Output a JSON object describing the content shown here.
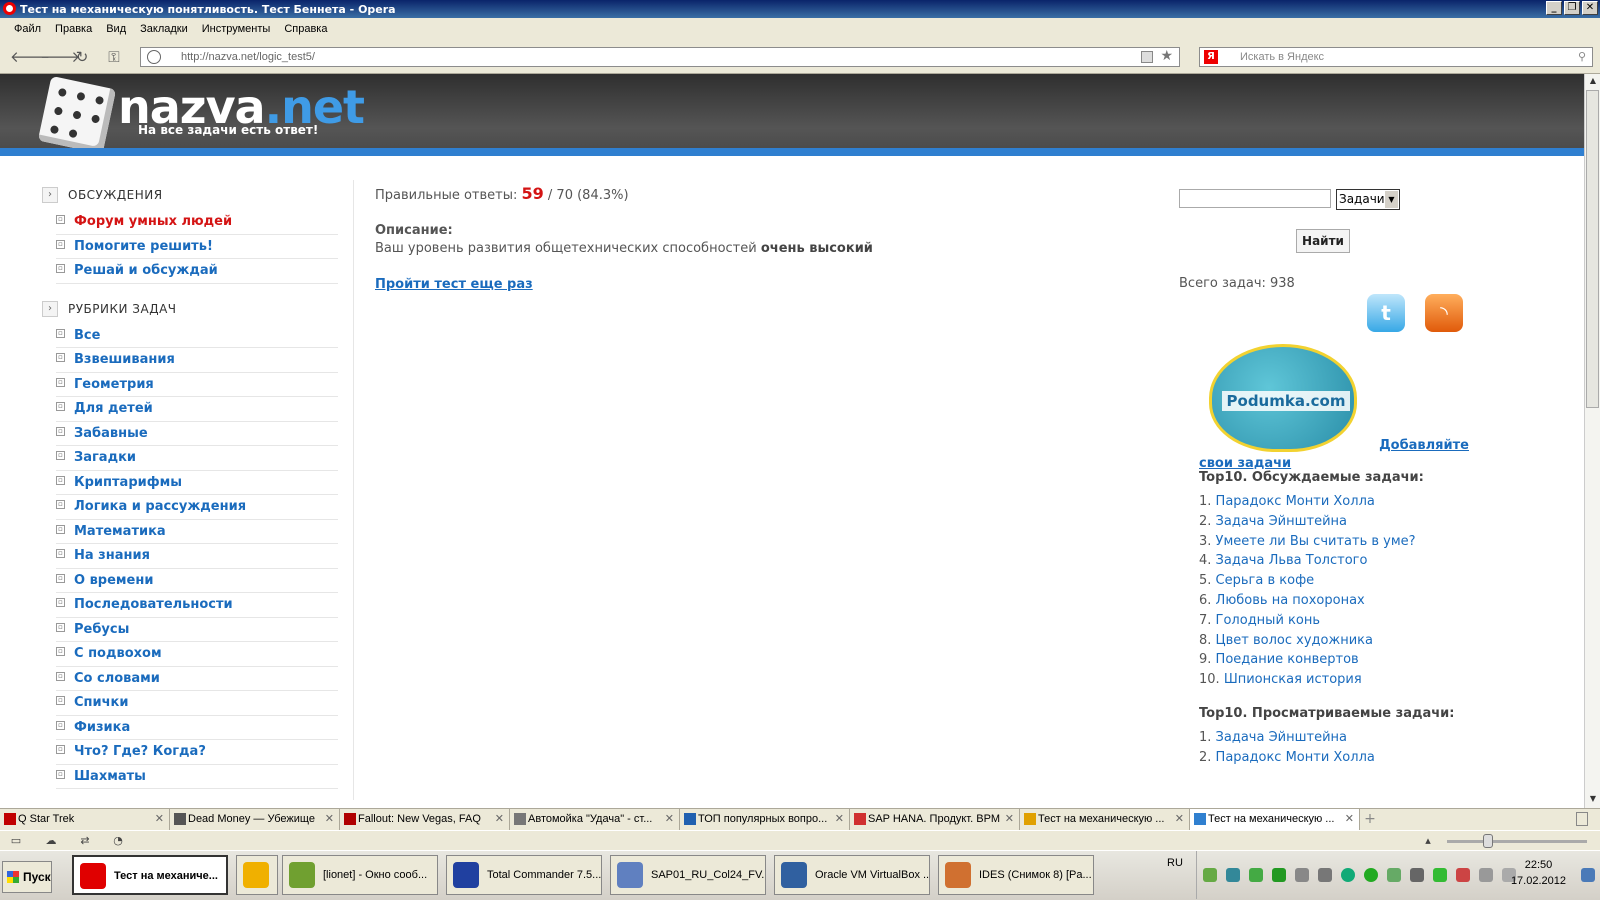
{
  "window": {
    "title": "Тест на механическую понятливость. Тест Беннета - Opera"
  },
  "menu": [
    "Файл",
    "Правка",
    "Вид",
    "Закладки",
    "Инструменты",
    "Справка"
  ],
  "address": {
    "url": "http://nazva.net/logic_test5/",
    "search_placeholder": "Искать в Яндекс"
  },
  "site": {
    "logo_main": "nazva",
    "logo_tld": ".net",
    "slogan": "На все задачи есть ответ!"
  },
  "sidebar": {
    "discussions_title": "ОБСУЖДЕНИЯ",
    "discussions": [
      {
        "label": "Форум умных людей",
        "highlight": true
      },
      {
        "label": "Помогите решить!",
        "highlight": false
      },
      {
        "label": "Решай и обсуждай",
        "highlight": false
      }
    ],
    "rubrics_title": "РУБРИКИ ЗАДАЧ",
    "rubrics": [
      "Все",
      "Взвешивания",
      "Геометрия",
      "Для детей",
      "Забавные",
      "Загадки",
      "Криптарифмы",
      "Логика и рассуждения",
      "Математика",
      "На знания",
      "О времени",
      "Последовательности",
      "Ребусы",
      "С подвохом",
      "Со словами",
      "Спички",
      "Физика",
      "Что? Где? Когда?",
      "Шахматы"
    ]
  },
  "main": {
    "score_prefix": "Правильные ответы:",
    "score_correct": "59",
    "score_rest": "/ 70 (84.3%)",
    "description_label": "Описание:",
    "description_text": "Ваш уровень развития общетехнических способностей",
    "description_bold": "очень высокий",
    "retry_link": "Пройти тест еще раз"
  },
  "right": {
    "search_category": "Задачи",
    "search_button": "Найти",
    "total_tasks": "Всего задач: 938",
    "podumka_label": "Podumka.com",
    "add_tasks_link_1": "Добавляйте",
    "add_tasks_link_2": "свои задачи",
    "top_discussed_title": "Top10. Обсуждаемые задачи:",
    "top_discussed": [
      "Парадокс Монти Холла",
      "Задача Эйнштейна",
      "Умеете ли Вы считать в уме?",
      "Задача Льва Толстого",
      "Серьга в кофе",
      "Любовь на похоронах",
      "Голодный конь",
      "Цвет волос художника",
      "Поедание конвертов",
      "Шпионская история"
    ],
    "top_viewed_title": "Top10. Просматриваемые задачи:",
    "top_viewed": [
      "Задача Эйнштейна",
      "Парадокс Монти Холла"
    ]
  },
  "tabs": [
    {
      "label": "Q Star Trek",
      "icon_color": "#c00000",
      "active": false
    },
    {
      "label": "Dead Money — Убежище",
      "icon_color": "#555555",
      "active": false
    },
    {
      "label": "Fallout: New Vegas, FAQ",
      "icon_color": "#b00000",
      "active": false
    },
    {
      "label": "Автомойка \"Удача\" - ст...",
      "icon_color": "#777777",
      "active": false
    },
    {
      "label": "ТОП популярных вопро...",
      "icon_color": "#2060b0",
      "active": false
    },
    {
      "label": "SAP HANA. Продукт. BPM",
      "icon_color": "#d03030",
      "active": false
    },
    {
      "label": "Тест на механическую ...",
      "icon_color": "#e0a000",
      "active": false
    },
    {
      "label": "Тест на механическую ...",
      "icon_color": "#3080d0",
      "active": true
    }
  ],
  "taskbar": {
    "start": "Пуск",
    "tasks": [
      {
        "label": "Тест на механиче...",
        "icon_color": "#e00000",
        "active": true
      },
      {
        "label": "",
        "icon_color": "#f0b000",
        "active": false
      },
      {
        "label": "[lionet] - Окно сооб...",
        "icon_color": "#70a030",
        "active": false
      },
      {
        "label": "Total Commander 7.5...",
        "icon_color": "#2040a0",
        "active": false
      },
      {
        "label": "SAP01_RU_Col24_FV...",
        "icon_color": "#6080c0",
        "active": false
      },
      {
        "label": "Oracle VM VirtualBox ...",
        "icon_color": "#3060a0",
        "active": false
      },
      {
        "label": "IDES (Снимок 8) [Pa...",
        "icon_color": "#d07030",
        "active": false
      }
    ],
    "lang": "RU",
    "time": "22:50",
    "date": "17.02.2012"
  }
}
